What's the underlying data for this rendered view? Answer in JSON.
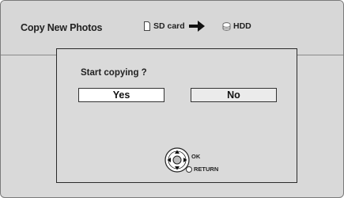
{
  "header": {
    "title": "Copy New Photos",
    "source_label": "SD card",
    "source_icon": "sd-card-icon",
    "arrow_icon": "arrow-right-icon",
    "destination_label": "HDD",
    "destination_icon": "hdd-icon"
  },
  "dialog": {
    "question": "Start copying ?",
    "yes_label": "Yes",
    "no_label": "No",
    "selected": "Yes"
  },
  "controls": {
    "nav_icon": "direction-pad-icon",
    "ok_label": "OK",
    "return_label": "RETURN",
    "return_icon": "return-circle-icon"
  }
}
